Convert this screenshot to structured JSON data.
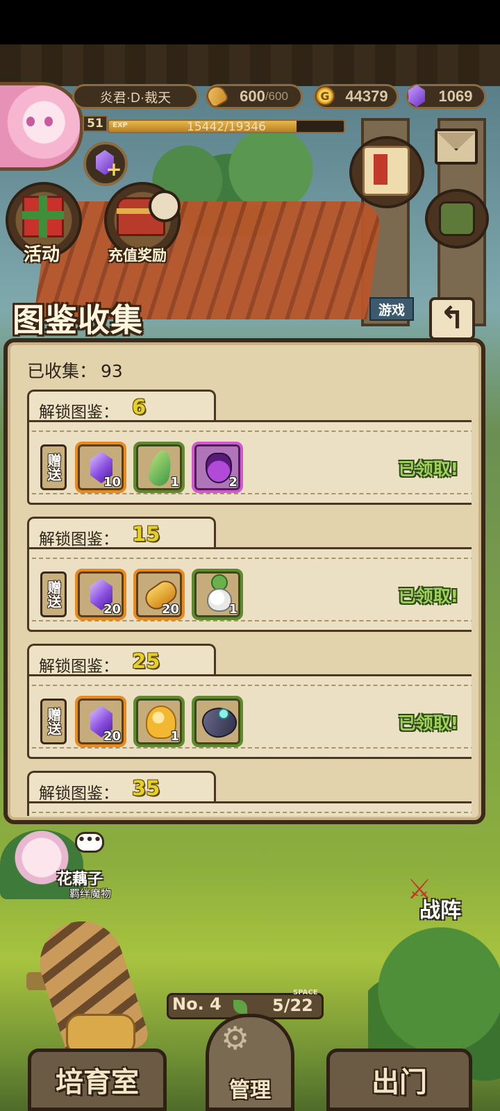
{
  "hud": {
    "player_name": "炎君·D·裁天",
    "level": "51",
    "exp_label": "EXP",
    "exp_text": "15442/19346",
    "exp_fraction": 0.798,
    "stamina": "600",
    "stamina_max": "/600",
    "gold": "44379",
    "gold_symbol": "G",
    "gems": "1069"
  },
  "side_buttons": {
    "events_label": "活动",
    "recharge_label": "充值奖励",
    "games_label": "游戏"
  },
  "panel": {
    "title": "图鉴收集",
    "collected_label": "已收集：",
    "collected_value": "93",
    "back_glyph": "↰",
    "cards": [
      {
        "unlock_label": "解锁图鉴：",
        "unlock_value": "6",
        "gift_label": "赠送",
        "status": "已领取!",
        "items": [
          {
            "icon": "purple-gem-icon",
            "qty": "10",
            "frame": "orange"
          },
          {
            "icon": "green-leaf-icon",
            "qty": "1",
            "frame": "green"
          },
          {
            "icon": "purple-potion-icon",
            "qty": "2",
            "frame": "purple"
          }
        ]
      },
      {
        "unlock_label": "解锁图鉴：",
        "unlock_value": "15",
        "gift_label": "赠送",
        "status": "已领取!",
        "items": [
          {
            "icon": "purple-gem-icon",
            "qty": "20",
            "frame": "orange"
          },
          {
            "icon": "bread-icon",
            "qty": "20",
            "frame": "orange"
          },
          {
            "icon": "radish-icon",
            "qty": "1",
            "frame": "green"
          }
        ]
      },
      {
        "unlock_label": "解锁图鉴：",
        "unlock_value": "25",
        "gift_label": "赠送",
        "status": "已领取!",
        "items": [
          {
            "icon": "purple-gem-icon",
            "qty": "20",
            "frame": "orange"
          },
          {
            "icon": "yellow-slime-icon",
            "qty": "1",
            "frame": "green"
          },
          {
            "icon": "gauntlet-icon",
            "qty": "",
            "frame": "green"
          }
        ]
      },
      {
        "unlock_label": "解锁图鉴：",
        "unlock_value": "35"
      }
    ]
  },
  "scene": {
    "npc_bubble": "•••",
    "npc_name": "花藕子",
    "npc_subtitle": "羁绊魔物",
    "formation_label": "战阵",
    "space_no": "No. 4",
    "space_tag": "SPACE",
    "space_count": "5/22"
  },
  "nav": {
    "left": "培育室",
    "middle": "管理",
    "right": "出门"
  }
}
